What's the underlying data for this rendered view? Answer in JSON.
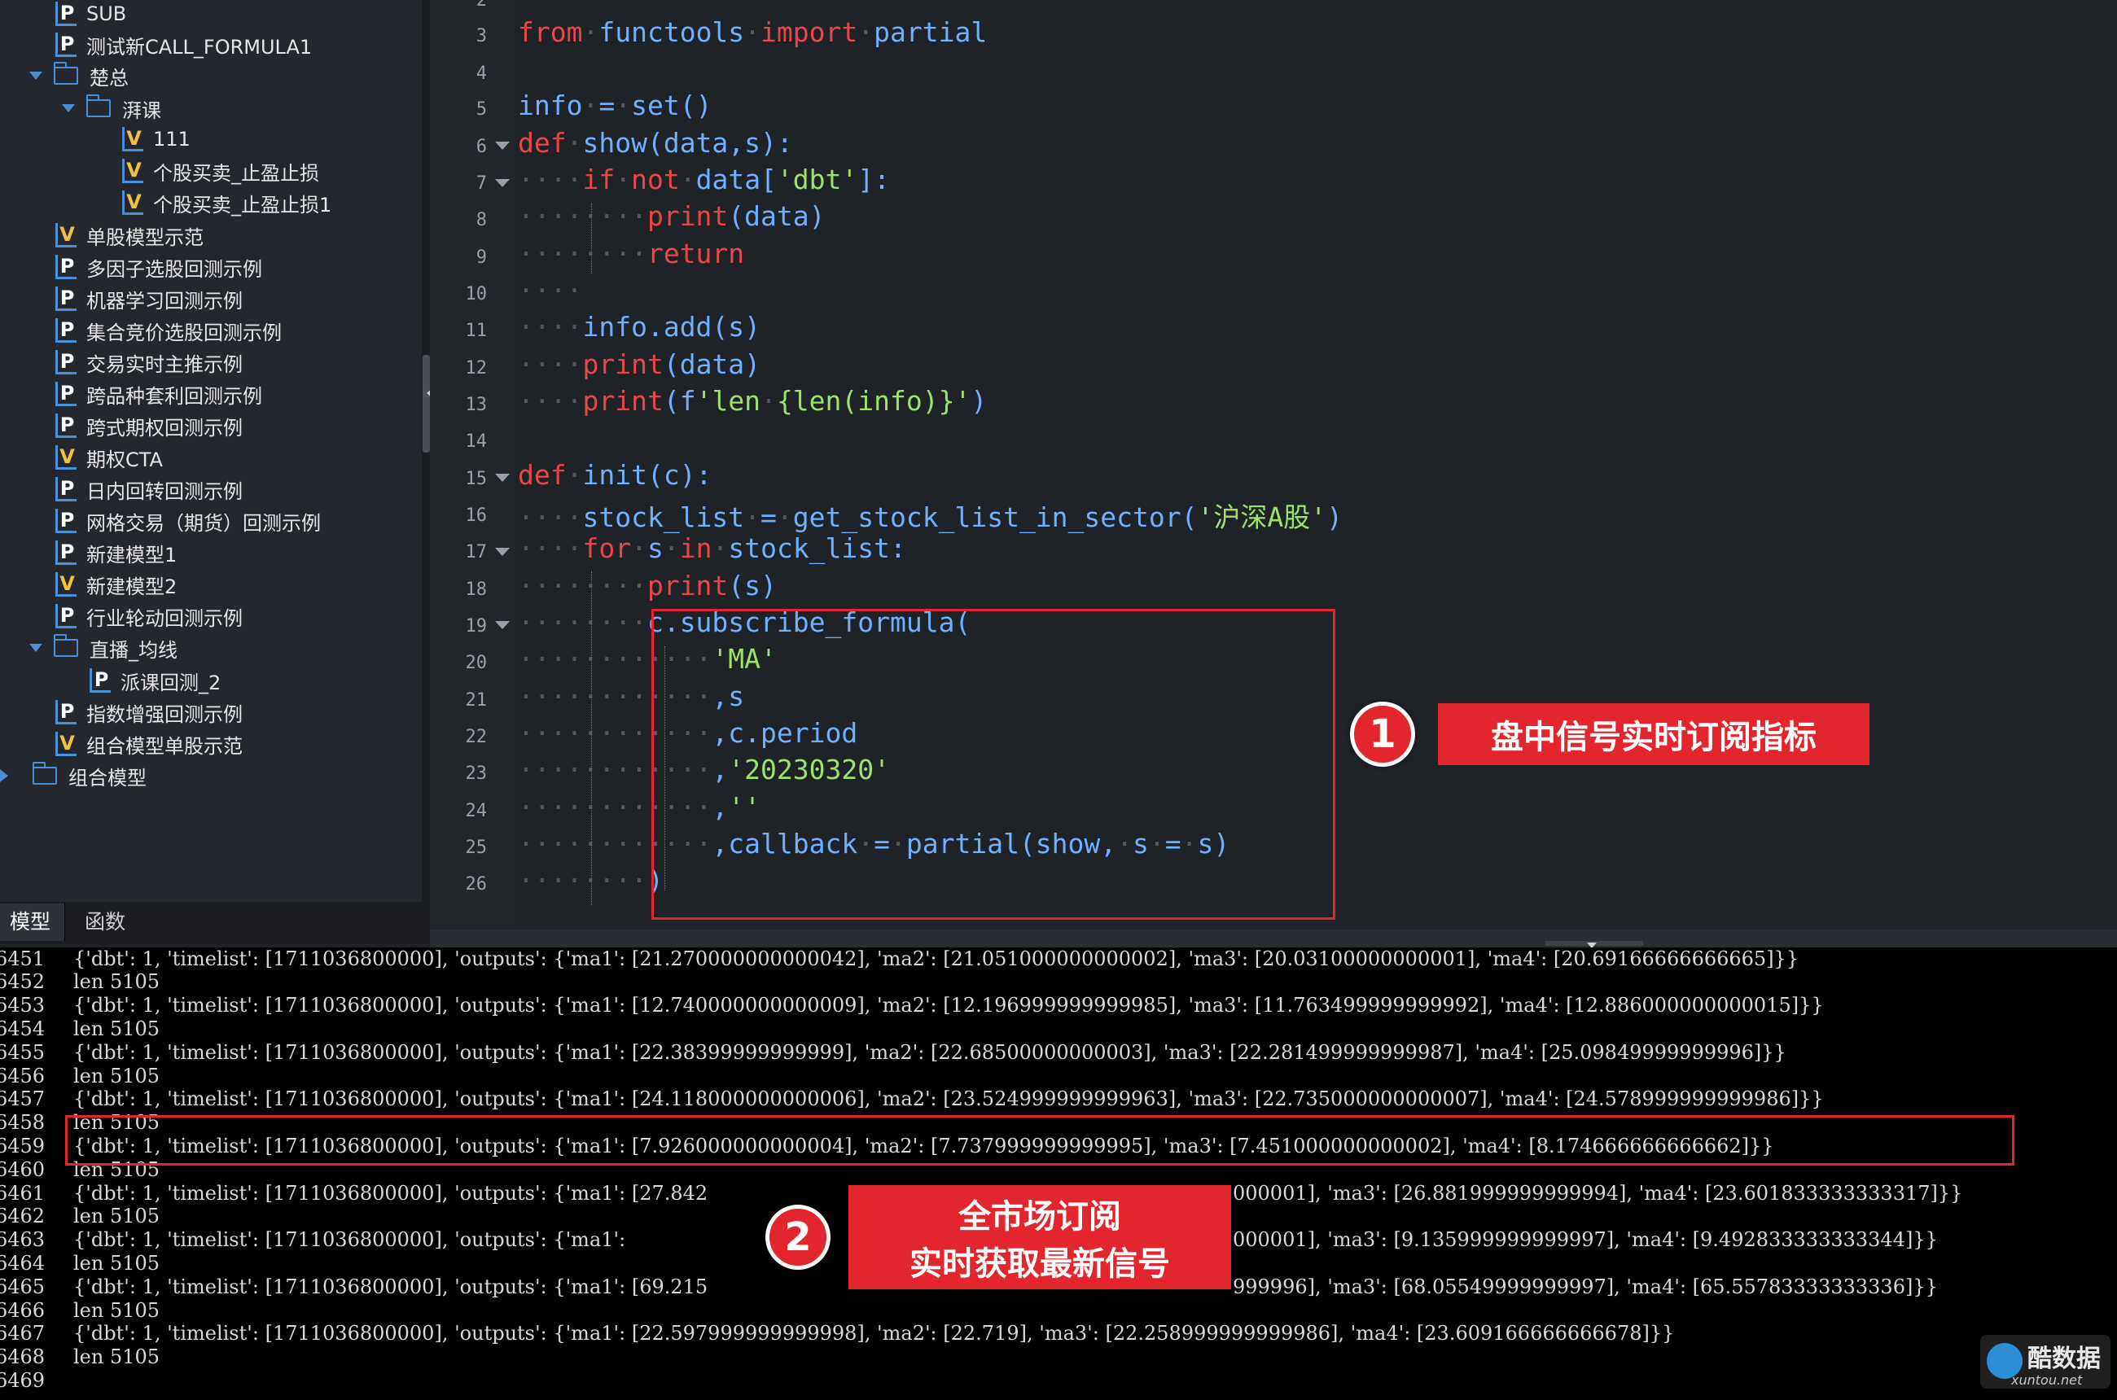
{
  "tree": {
    "items": [
      {
        "label": "SUB",
        "type": "P",
        "kind": "file"
      },
      {
        "label": "测试新CALL_FORMULA1",
        "type": "P",
        "kind": "file"
      },
      {
        "label": "楚总",
        "type": "",
        "kind": "folder-open"
      },
      {
        "label": "湃课",
        "type": "",
        "kind": "folder-open"
      },
      {
        "label": "111",
        "type": "V",
        "kind": "file"
      },
      {
        "label": "个股买卖_止盈止损",
        "type": "V",
        "kind": "file"
      },
      {
        "label": "个股买卖_止盈止损1",
        "type": "V",
        "kind": "file"
      },
      {
        "label": "单股模型示范",
        "type": "V",
        "kind": "file"
      },
      {
        "label": "多因子选股回测示例",
        "type": "P",
        "kind": "file"
      },
      {
        "label": "机器学习回测示例",
        "type": "P",
        "kind": "file"
      },
      {
        "label": "集合竞价选股回测示例",
        "type": "P",
        "kind": "file"
      },
      {
        "label": "交易实时主推示例",
        "type": "P",
        "kind": "file"
      },
      {
        "label": "跨品种套利回测示例",
        "type": "P",
        "kind": "file"
      },
      {
        "label": "跨式期权回测示例",
        "type": "P",
        "kind": "file"
      },
      {
        "label": "期权CTA",
        "type": "V",
        "kind": "file"
      },
      {
        "label": "日内回转回测示例",
        "type": "P",
        "kind": "file"
      },
      {
        "label": "网格交易（期货）回测示例",
        "type": "P",
        "kind": "file"
      },
      {
        "label": "新建模型1",
        "type": "P",
        "kind": "file"
      },
      {
        "label": "新建模型2",
        "type": "V",
        "kind": "file"
      },
      {
        "label": "行业轮动回测示例",
        "type": "P",
        "kind": "file"
      },
      {
        "label": "直播_均线",
        "type": "",
        "kind": "folder-open"
      },
      {
        "label": "派课回测_2",
        "type": "P",
        "kind": "file"
      },
      {
        "label": "指数增强回测示例",
        "type": "P",
        "kind": "file"
      },
      {
        "label": "组合模型单股示范",
        "type": "V",
        "kind": "file"
      },
      {
        "label": "组合模型",
        "type": "",
        "kind": "folder-closed"
      }
    ]
  },
  "tabs": {
    "model": "模型",
    "function": "函数"
  },
  "editor": {
    "line_numbers": [
      "2",
      "3",
      "4",
      "5",
      "6",
      "7",
      "8",
      "9",
      "10",
      "11",
      "12",
      "13",
      "14",
      "15",
      "16",
      "17",
      "18",
      "19",
      "20",
      "21",
      "22",
      "23",
      "24",
      "25",
      "26"
    ]
  },
  "console": {
    "line_numbers": [
      "6451",
      "6452",
      "6453",
      "6454",
      "6455",
      "6456",
      "6457",
      "6458",
      "6459",
      "6460",
      "6461",
      "6462",
      "6463",
      "6464",
      "6465",
      "6466",
      "6467",
      "6468",
      "6469"
    ],
    "lines": [
      "{'dbt': 1, 'timelist': [1711036800000], 'outputs': {'ma1': [21.270000000000042], 'ma2': [21.051000000000002], 'ma3': [20.03100000000001], 'ma4': [20.69166666666665]}}",
      "len 5105",
      "{'dbt': 1, 'timelist': [1711036800000], 'outputs': {'ma1': [12.740000000000009], 'ma2': [12.196999999999985], 'ma3': [11.763499999999992], 'ma4': [12.886000000000015]}}",
      "len 5105",
      "{'dbt': 1, 'timelist': [1711036800000], 'outputs': {'ma1': [22.38399999999999], 'ma2': [22.68500000000003], 'ma3': [22.281499999999987], 'ma4': [25.09849999999996]}}",
      "len 5105",
      "{'dbt': 1, 'timelist': [1711036800000], 'outputs': {'ma1': [24.118000000000006], 'ma2': [23.524999999999963], 'ma3': [22.735000000000007], 'ma4': [24.578999999999986]}}",
      "len 5105",
      "{'dbt': 1, 'timelist': [1711036800000], 'outputs': {'ma1': [7.926000000000004], 'ma2': [7.737999999999995], 'ma3': [7.451000000000002], 'ma4': [8.174666666666662]}}",
      "len 5105",
      "{'dbt': 1, 'timelist': [1711036800000], 'outputs': {'ma1': [27.842",
      "len 5105",
      "{'dbt': 1, 'timelist': [1711036800000], 'outputs': {'ma1': ",
      "len 5105",
      "{'dbt': 1, 'timelist': [1711036800000], 'outputs': {'ma1': [69.215",
      "len 5105",
      "{'dbt': 1, 'timelist': [1711036800000], 'outputs': {'ma1': [22.597999999999998], 'ma2': [22.719], 'ma3': [22.258999999999986], 'ma4': [23.609166666666678]}}",
      "len 5105",
      ""
    ],
    "line_tails": {
      "l11": "000001], 'ma3': [26.881999999999994], 'ma4': [23.601833333333317]}}",
      "l13": "000001], 'ma3': [9.135999999999997], 'ma4': [9.492833333333344]}}",
      "l15": "999996], 'ma3': [68.05549999999997], 'ma4': [65.55783333333336]}}"
    }
  },
  "annotations": {
    "one": {
      "number": "1",
      "text": "盘中信号实时订阅指标"
    },
    "two": {
      "number": "2",
      "text_line1": "全市场订阅",
      "text_line2": "实时获取最新信号"
    }
  },
  "watermark": {
    "text": "酷数据",
    "sub": "xuntou.net"
  },
  "colors": {
    "accent_red": "#e3262e",
    "keyword": "#e8474a",
    "identifier": "#6fb1ff",
    "string": "#c9d24a"
  }
}
